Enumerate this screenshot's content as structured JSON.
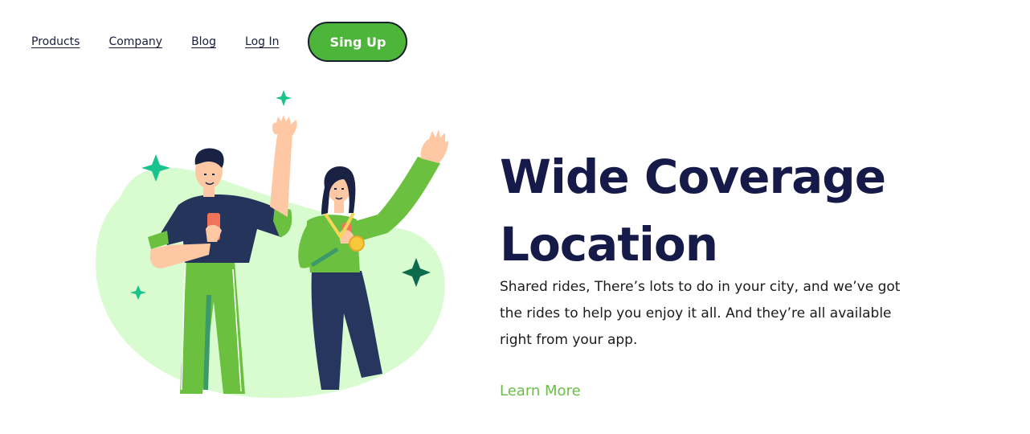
{
  "nav": {
    "links": [
      "Products",
      "Company",
      "Blog",
      "Log In"
    ],
    "signup_label": "Sing Up"
  },
  "hero": {
    "title_line1": "Wide Coverage",
    "title_line2": "Location",
    "description": "Shared rides, There’s lots to do in your city, and we’ve got the rides to help you enjoy it all. And they’re all available right from your app.",
    "cta_label": "Learn More"
  },
  "colors": {
    "title": "#151a49",
    "accent_green": "#4cb53a",
    "link_green": "#6bbf47",
    "blob": "#d9fbd0",
    "sparkle": "#19c38d",
    "sparkle_dark": "#0b6b4c"
  },
  "icons": {
    "illustration": "two-people-waving-illustration",
    "sparkles": "sparkle-icon"
  }
}
